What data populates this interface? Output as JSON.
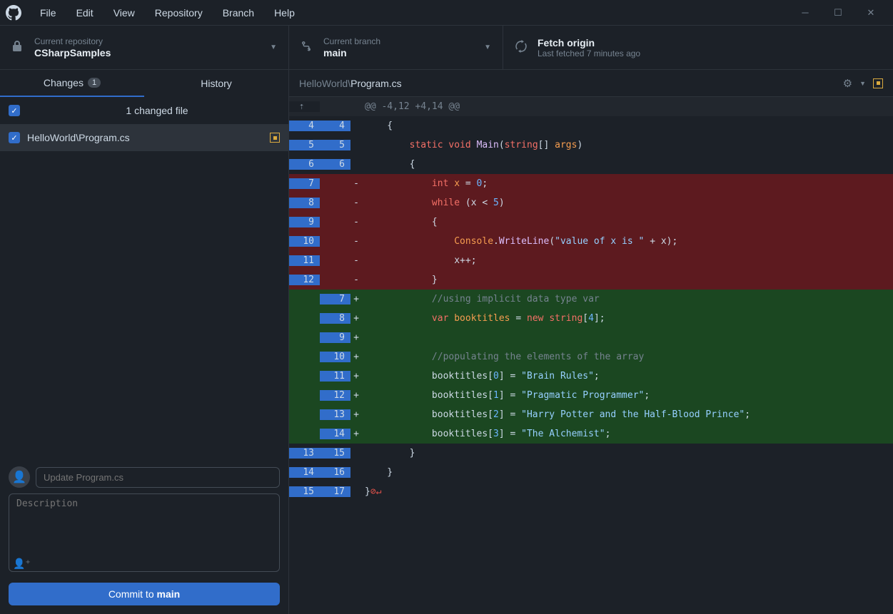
{
  "menu": [
    "File",
    "Edit",
    "View",
    "Repository",
    "Branch",
    "Help"
  ],
  "toolbar": {
    "repo_label": "Current repository",
    "repo_value": "CSharpSamples",
    "branch_label": "Current branch",
    "branch_value": "main",
    "fetch_label": "Fetch origin",
    "fetch_value": "Last fetched 7 minutes ago"
  },
  "tabs": {
    "changes": "Changes",
    "changes_count": "1",
    "history": "History"
  },
  "filelist": {
    "summary": "1 changed file",
    "file": "HelloWorld\\Program.cs"
  },
  "commit": {
    "summary_placeholder": "Update Program.cs",
    "description_placeholder": "Description",
    "button_prefix": "Commit to ",
    "button_branch": "main"
  },
  "diff": {
    "path_prefix": "HelloWorld\\",
    "path_file": "Program.cs",
    "hunk_header": "@@ -4,12 +4,14 @@",
    "lines": [
      {
        "t": "ctx",
        "o": "4",
        "n": "4",
        "code": "    {"
      },
      {
        "t": "ctx",
        "o": "5",
        "n": "5",
        "code": "        <span class='tok-kw'>static</span> <span class='tok-kw'>void</span> <span class='tok-fn'>Main</span>(<span class='tok-kw'>string</span>[] <span class='tok-type'>args</span>)"
      },
      {
        "t": "ctx",
        "o": "6",
        "n": "6",
        "code": "        {"
      },
      {
        "t": "del",
        "o": "7",
        "n": "",
        "code": "            <span class='tok-kw'>int</span> <span class='tok-type'>x</span> = <span class='tok-num'>0</span>;"
      },
      {
        "t": "del",
        "o": "8",
        "n": "",
        "code": "            <span class='tok-kw'>while</span> (x &lt; <span class='tok-num'>5</span>)"
      },
      {
        "t": "del",
        "o": "9",
        "n": "",
        "code": "            {"
      },
      {
        "t": "del",
        "o": "10",
        "n": "",
        "code": "                <span class='tok-type'>Console</span>.<span class='tok-fn'>WriteLine</span>(<span class='tok-str'>\"value of x is \"</span> + x);"
      },
      {
        "t": "del",
        "o": "11",
        "n": "",
        "code": "                x++;"
      },
      {
        "t": "del",
        "o": "12",
        "n": "",
        "code": "            }"
      },
      {
        "t": "add",
        "o": "",
        "n": "7",
        "code": "            <span class='tok-cmt'>//using implicit data type var</span>"
      },
      {
        "t": "add",
        "o": "",
        "n": "8",
        "code": "            <span class='tok-kw'>var</span> <span class='tok-type'>booktitles</span> = <span class='tok-kw'>new</span> <span class='tok-kw'>string</span>[<span class='tok-num'>4</span>];"
      },
      {
        "t": "add",
        "o": "",
        "n": "9",
        "code": ""
      },
      {
        "t": "add",
        "o": "",
        "n": "10",
        "code": "            <span class='tok-cmt'>//populating the elements of the array</span>"
      },
      {
        "t": "add",
        "o": "",
        "n": "11",
        "code": "            booktitles[<span class='tok-num'>0</span>] = <span class='tok-str'>\"Brain Rules\"</span>;"
      },
      {
        "t": "add",
        "o": "",
        "n": "12",
        "code": "            booktitles[<span class='tok-num'>1</span>] = <span class='tok-str'>\"Pragmatic Programmer\"</span>;"
      },
      {
        "t": "add",
        "o": "",
        "n": "13",
        "code": "            booktitles[<span class='tok-num'>2</span>] = <span class='tok-str'>\"Harry Potter and the Half-Blood Prince\"</span>;"
      },
      {
        "t": "add",
        "o": "",
        "n": "14",
        "code": "            booktitles[<span class='tok-num'>3</span>] = <span class='tok-str'>\"The Alchemist\"</span>;"
      },
      {
        "t": "ctx",
        "o": "13",
        "n": "15",
        "code": "        }"
      },
      {
        "t": "ctx",
        "o": "14",
        "n": "16",
        "code": "    }"
      },
      {
        "t": "ctx",
        "o": "15",
        "n": "17",
        "code": "}<span class='tok-err'>⊘</span><span class='tok-nl'>↵</span>"
      }
    ]
  }
}
